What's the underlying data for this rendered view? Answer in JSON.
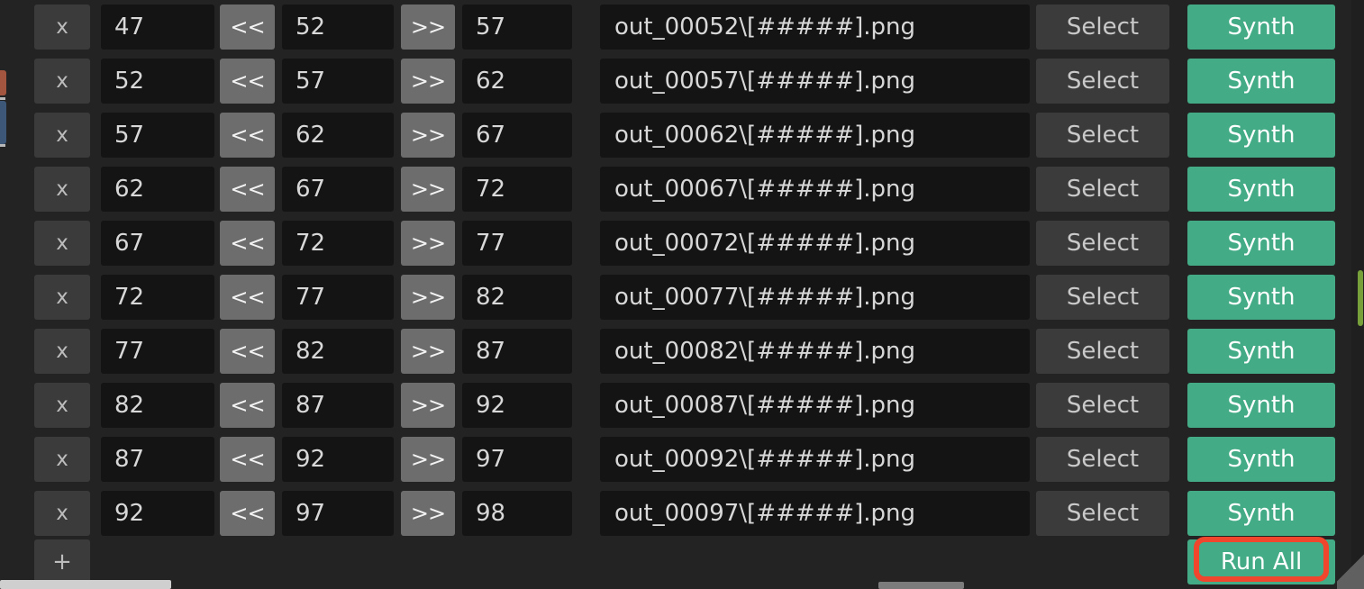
{
  "colors": {
    "background": "#232323",
    "field": "#141414",
    "button": "#3b3b3b",
    "step_button": "#6d6d6d",
    "accent_green": "#43ab86",
    "highlight_red": "#f0462d",
    "scroll_green": "#77a03a"
  },
  "table": {
    "row_labels": {
      "delete": "x",
      "prev": "<<",
      "next": ">>",
      "select": "Select",
      "synth": "Synth"
    },
    "rows": [
      {
        "delete": "x",
        "start": "47",
        "prev": "<<",
        "current": "52",
        "next": ">>",
        "end": "57",
        "filename": "out_00052\\[#####].png",
        "select": "Select",
        "synth": "Synth"
      },
      {
        "delete": "x",
        "start": "52",
        "prev": "<<",
        "current": "57",
        "next": ">>",
        "end": "62",
        "filename": "out_00057\\[#####].png",
        "select": "Select",
        "synth": "Synth"
      },
      {
        "delete": "x",
        "start": "57",
        "prev": "<<",
        "current": "62",
        "next": ">>",
        "end": "67",
        "filename": "out_00062\\[#####].png",
        "select": "Select",
        "synth": "Synth"
      },
      {
        "delete": "x",
        "start": "62",
        "prev": "<<",
        "current": "67",
        "next": ">>",
        "end": "72",
        "filename": "out_00067\\[#####].png",
        "select": "Select",
        "synth": "Synth"
      },
      {
        "delete": "x",
        "start": "67",
        "prev": "<<",
        "current": "72",
        "next": ">>",
        "end": "77",
        "filename": "out_00072\\[#####].png",
        "select": "Select",
        "synth": "Synth"
      },
      {
        "delete": "x",
        "start": "72",
        "prev": "<<",
        "current": "77",
        "next": ">>",
        "end": "82",
        "filename": "out_00077\\[#####].png",
        "select": "Select",
        "synth": "Synth"
      },
      {
        "delete": "x",
        "start": "77",
        "prev": "<<",
        "current": "82",
        "next": ">>",
        "end": "87",
        "filename": "out_00082\\[#####].png",
        "select": "Select",
        "synth": "Synth"
      },
      {
        "delete": "x",
        "start": "82",
        "prev": "<<",
        "current": "87",
        "next": ">>",
        "end": "92",
        "filename": "out_00087\\[#####].png",
        "select": "Select",
        "synth": "Synth"
      },
      {
        "delete": "x",
        "start": "87",
        "prev": "<<",
        "current": "92",
        "next": ">>",
        "end": "97",
        "filename": "out_00092\\[#####].png",
        "select": "Select",
        "synth": "Synth"
      },
      {
        "delete": "x",
        "start": "92",
        "prev": "<<",
        "current": "97",
        "next": ">>",
        "end": "98",
        "filename": "out_00097\\[#####].png",
        "select": "Select",
        "synth": "Synth"
      }
    ]
  },
  "footer": {
    "add_label": "+",
    "run_all_label": "Run All"
  }
}
